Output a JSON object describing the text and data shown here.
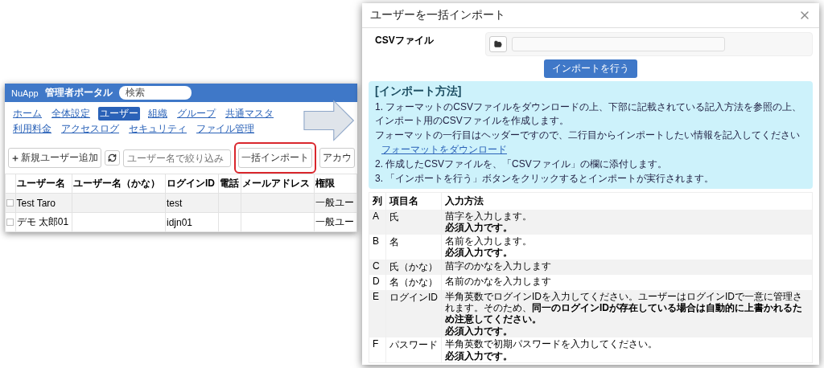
{
  "admin_screenshot": {
    "header": {
      "logo": "NuApp",
      "title": "管理者ポータル",
      "search_value": "検索"
    },
    "nav": [
      {
        "label": "ホーム",
        "selected": false
      },
      {
        "label": "全体設定",
        "selected": false
      },
      {
        "label": "ユーザー",
        "selected": true
      },
      {
        "label": "組織",
        "selected": false
      },
      {
        "label": "グループ",
        "selected": false
      },
      {
        "label": "共通マスタ",
        "selected": false
      },
      {
        "label": "利用料金",
        "selected": false
      },
      {
        "label": "アクセスログ",
        "selected": false
      },
      {
        "label": "セキュリティ",
        "selected": false
      },
      {
        "label": "ファイル管理",
        "selected": false
      }
    ],
    "toolbar": {
      "add_button": "新規ユーザー追加",
      "filter_placeholder": "ユーザー名で絞り込み",
      "import_button": "一括インポート",
      "import_highlighted": true,
      "account_button": "アカウ"
    },
    "table": {
      "columns": [
        "ユーザー名",
        "ユーザー名（かな）",
        "ログインID",
        "電話",
        "メールアドレス",
        "権限"
      ],
      "rows": [
        {
          "checked": false,
          "cells": [
            "Test Taro",
            "",
            "test",
            "",
            "",
            "一般ユー"
          ]
        },
        {
          "checked": false,
          "cells": [
            "デモ 太郎01",
            "",
            "idjn01",
            "",
            "",
            "一般ユー"
          ]
        }
      ]
    }
  },
  "import_dialog": {
    "title": "ユーザーを一括インポート",
    "file_label": "CSVファイル",
    "submit_button": "インポートを行う",
    "instructions": {
      "title": "[インポート方法]",
      "lines": [
        {
          "kind": "text",
          "text": "1. フォーマットのCSVファイルをダウンロードの上、下部に記載されている記入方法を参照の上、インポート用のCSVファイルを作成します。"
        },
        {
          "kind": "text",
          "text": "フォーマットの一行目はヘッダーですので、二行目からインポートしたい情報を記入してください"
        },
        {
          "kind": "link",
          "text": "フォーマットをダウンロード"
        },
        {
          "kind": "text",
          "text": "2. 作成したCSVファイルを、「CSVファイル」の欄に添付します。"
        },
        {
          "kind": "text",
          "text": "3. 「インポートを行う」ボタンをクリックするとインポートが実行されます。"
        }
      ]
    },
    "table": {
      "columns": [
        "列",
        "項目名",
        "入力方法"
      ],
      "rows": [
        {
          "col": "A",
          "name": "氏",
          "lines": [
            {
              "text": "苗字を入力します。",
              "bold": false
            },
            {
              "text": "必須入力です。",
              "bold": true
            }
          ]
        },
        {
          "col": "B",
          "name": "名",
          "lines": [
            {
              "text": "名前を入力します。",
              "bold": false
            },
            {
              "text": "必須入力です。",
              "bold": true
            }
          ]
        },
        {
          "col": "C",
          "name": "氏（かな）",
          "lines": [
            {
              "text": "苗字のかなを入力します",
              "bold": false
            }
          ]
        },
        {
          "col": "D",
          "name": "名（かな）",
          "lines": [
            {
              "text": "名前のかなを入力します",
              "bold": false
            }
          ]
        },
        {
          "col": "E",
          "name": "ログインID",
          "lines": [
            {
              "text": "半角英数でログインIDを入力してください。ユーザーはログインIDで一意に管理されます。そのため、**同一のログインIDが存在している場合は自動的に上書かれるため注意してください。**",
              "bold": false
            },
            {
              "text": "必須入力です。",
              "bold": true
            }
          ]
        },
        {
          "col": "F",
          "name": "パスワード",
          "lines": [
            {
              "text": "半角英数で初期パスワードを入力してください。",
              "bold": false
            },
            {
              "text": "必須入力です。",
              "bold": true
            }
          ]
        }
      ]
    }
  }
}
